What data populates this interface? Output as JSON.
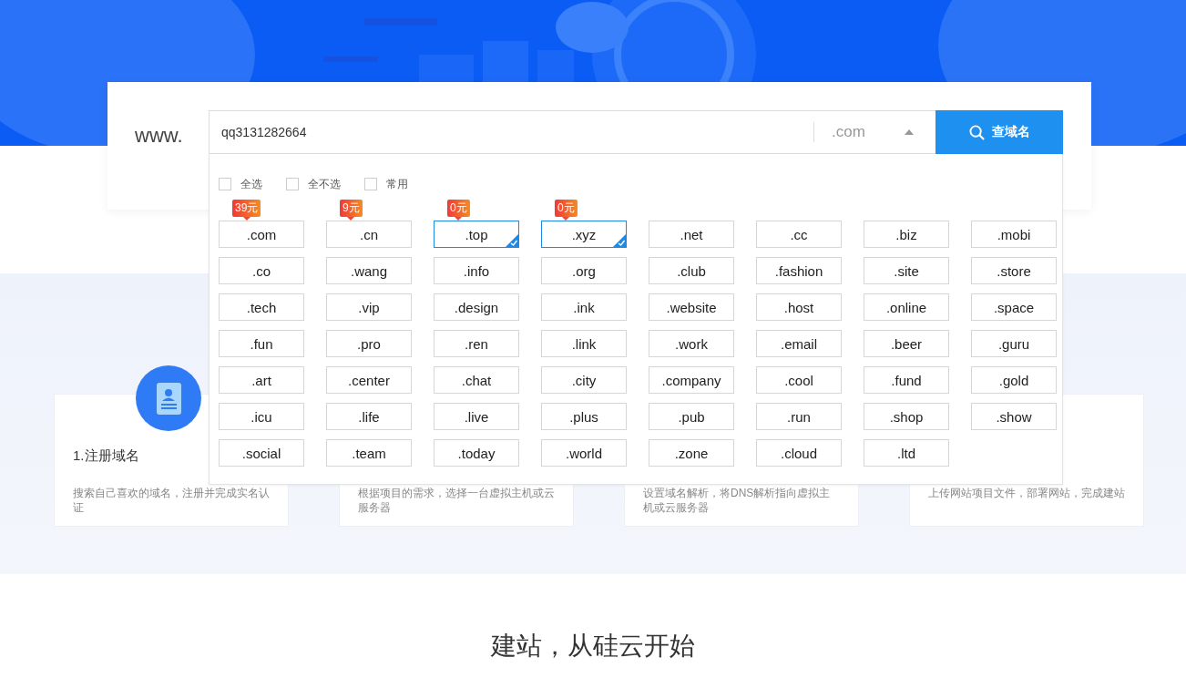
{
  "search": {
    "prefix": "www.",
    "value": "qq3131282664",
    "suffix": ".com",
    "suffix_expanded": true,
    "button": "查域名"
  },
  "dropdown": {
    "options": [
      {
        "label": "全选",
        "checked": false
      },
      {
        "label": "全不选",
        "checked": false
      },
      {
        "label": "常用",
        "checked": false
      }
    ],
    "domains": [
      {
        "name": ".com",
        "selected": false,
        "price": "39元"
      },
      {
        "name": ".cn",
        "selected": false,
        "price": "9元"
      },
      {
        "name": ".top",
        "selected": true,
        "price": "0元"
      },
      {
        "name": ".xyz",
        "selected": true,
        "price": "0元"
      },
      {
        "name": ".net",
        "selected": false
      },
      {
        "name": ".cc",
        "selected": false
      },
      {
        "name": ".biz",
        "selected": false
      },
      {
        "name": ".mobi",
        "selected": false
      },
      {
        "name": ".co",
        "selected": false
      },
      {
        "name": ".wang",
        "selected": false
      },
      {
        "name": ".info",
        "selected": false
      },
      {
        "name": ".org",
        "selected": false
      },
      {
        "name": ".club",
        "selected": false
      },
      {
        "name": ".fashion",
        "selected": false
      },
      {
        "name": ".site",
        "selected": false
      },
      {
        "name": ".store",
        "selected": false
      },
      {
        "name": ".tech",
        "selected": false
      },
      {
        "name": ".vip",
        "selected": false
      },
      {
        "name": ".design",
        "selected": false
      },
      {
        "name": ".ink",
        "selected": false
      },
      {
        "name": ".website",
        "selected": false
      },
      {
        "name": ".host",
        "selected": false
      },
      {
        "name": ".online",
        "selected": false
      },
      {
        "name": ".space",
        "selected": false
      },
      {
        "name": ".fun",
        "selected": false
      },
      {
        "name": ".pro",
        "selected": false
      },
      {
        "name": ".ren",
        "selected": false
      },
      {
        "name": ".link",
        "selected": false
      },
      {
        "name": ".work",
        "selected": false
      },
      {
        "name": ".email",
        "selected": false
      },
      {
        "name": ".beer",
        "selected": false
      },
      {
        "name": ".guru",
        "selected": false
      },
      {
        "name": ".art",
        "selected": false
      },
      {
        "name": ".center",
        "selected": false
      },
      {
        "name": ".chat",
        "selected": false
      },
      {
        "name": ".city",
        "selected": false
      },
      {
        "name": ".company",
        "selected": false
      },
      {
        "name": ".cool",
        "selected": false
      },
      {
        "name": ".fund",
        "selected": false
      },
      {
        "name": ".gold",
        "selected": false
      },
      {
        "name": ".icu",
        "selected": false
      },
      {
        "name": ".life",
        "selected": false
      },
      {
        "name": ".live",
        "selected": false
      },
      {
        "name": ".plus",
        "selected": false
      },
      {
        "name": ".pub",
        "selected": false
      },
      {
        "name": ".run",
        "selected": false
      },
      {
        "name": ".shop",
        "selected": false
      },
      {
        "name": ".show",
        "selected": false
      },
      {
        "name": ".social",
        "selected": false
      },
      {
        "name": ".team",
        "selected": false
      },
      {
        "name": ".today",
        "selected": false
      },
      {
        "name": ".world",
        "selected": false
      },
      {
        "name": ".zone",
        "selected": false
      },
      {
        "name": ".cloud",
        "selected": false
      },
      {
        "name": ".ltd",
        "selected": false
      }
    ]
  },
  "steps": [
    {
      "title": "1.注册域名",
      "description": "搜索自己喜欢的域名，注册并完成实名认证"
    },
    {
      "description": "根据项目的需求，选择一台虚拟主机或云服务器"
    },
    {
      "description": "设置域名解析，将DNS解析指向虚拟主机或云服务器"
    },
    {
      "description": "上传网站项目文件，部署网站，完成建站"
    }
  ],
  "heading": "建站，从硅云开始"
}
